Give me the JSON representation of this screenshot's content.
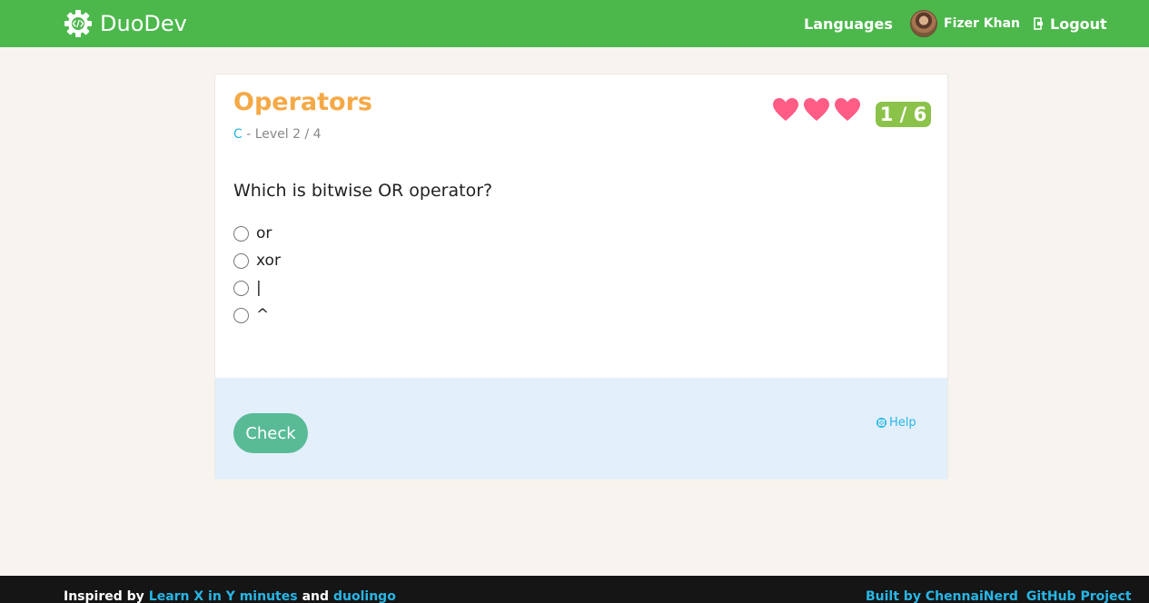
{
  "header": {
    "brand": "DuoDev",
    "nav_languages": "Languages",
    "user_name": "Fizer Khan",
    "logout": "Logout"
  },
  "lesson": {
    "title": "Operators",
    "language": "C",
    "level_separator": " - ",
    "level_text": "Level 2 / 4",
    "lives": 3,
    "progress": "1 / 6",
    "question": "Which is bitwise OR operator?",
    "options": [
      "or",
      "xor",
      "|",
      "^"
    ],
    "check_label": "Check",
    "help_label": "Help"
  },
  "footer": {
    "inspired_by": "Inspired by",
    "link_learnx": "Learn X in Y minutes",
    "and": "and",
    "link_duolingo": "duolingo",
    "built_by": "Built by ChennaiNerd",
    "github": "GitHub Project"
  },
  "colors": {
    "navbar": "#4cb84c",
    "title": "#f5a946",
    "accent_link": "#27b6e6",
    "heart": "#ff5c86",
    "progress_badge": "#8bc34a",
    "check_button": "#58bb96",
    "answer_panel": "#e3effa"
  },
  "icons": [
    "gear-code-icon",
    "logout-icon",
    "heart-icon",
    "help-lifebuoy-icon"
  ]
}
